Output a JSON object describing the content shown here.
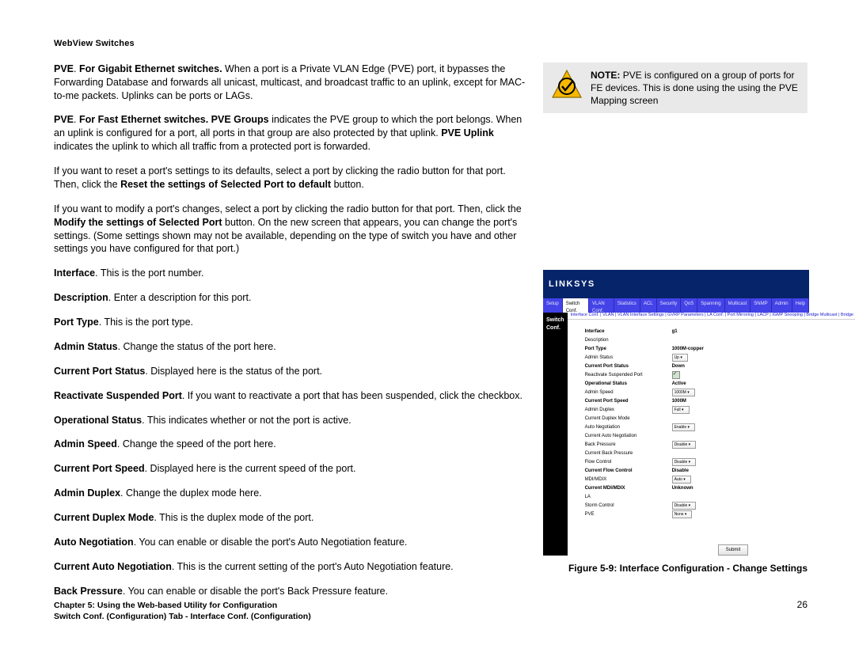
{
  "doc_title": "WebView Switches",
  "paragraphs": [
    {
      "bold_runs": [
        "PVE",
        ". ",
        "For Gigabit Ethernet switches.",
        " When a port is a Private VLAN Edge (PVE) port, it bypasses the Forwarding Database and forwards all unicast, multicast, and broadcast traffic to an uplink, except for MAC-to-me packets. Uplinks can be ports or LAGs."
      ]
    },
    {
      "bold_runs": [
        "PVE",
        ". ",
        "For Fast Ethernet switches. PVE Groups",
        " indicates the PVE group to which the port belongs. When an uplink is configured for a port, all ports in that group are also protected by that uplink. ",
        "PVE Uplink",
        " indicates the uplink to which all traffic from a protected port is forwarded."
      ]
    },
    {
      "plain_before": "If you want to reset a port's settings to its defaults, select a port by clicking the radio button for that port. Then, click the ",
      "bold": "Reset the settings of Selected Port to default",
      "plain_after": " button."
    },
    {
      "plain_before": "If you want to modify a port's changes, select a port by clicking the radio button for that port. Then, click the ",
      "bold": "Modify the settings of Selected Port",
      "plain_after": " button. On the new screen that appears, you can change the port's settings. (Some settings shown may not be available, depending on the type of switch you have and other settings you have configured for that port.)"
    }
  ],
  "fields": [
    {
      "label": "Interface",
      "text": ". This is the port number."
    },
    {
      "label": "Description",
      "text": ". Enter a description for this port."
    },
    {
      "label": "Port Type",
      "text": ". This is the port type."
    },
    {
      "label": "Admin Status",
      "text": ". Change the status of the port here."
    },
    {
      "label": "Current Port Status",
      "text": ". Displayed here is the status of the port."
    },
    {
      "label": "Reactivate Suspended Port",
      "text": ". If you want to reactivate a port that has been suspended, click the checkbox."
    },
    {
      "label": "Operational Status",
      "text": ". This indicates whether or not the port is active."
    },
    {
      "label": "Admin Speed",
      "text": ". Change the speed of the port here."
    },
    {
      "label": "Current Port Speed",
      "text": ". Displayed here is the current speed of the port."
    },
    {
      "label": "Admin Duplex",
      "text": ". Change the duplex mode here."
    },
    {
      "label": "Current Duplex Mode",
      "text": ". This is the duplex mode of the port."
    },
    {
      "label": "Auto Negotiation",
      "text": ". You can enable or disable the port's Auto Negotiation feature."
    },
    {
      "label": "Current Auto Negotiation",
      "text": ". This is the current setting of the port's Auto Negotiation feature."
    },
    {
      "label": "Back Pressure",
      "text": ". You can enable or disable the port's Back Pressure feature."
    }
  ],
  "note": {
    "label": "NOTE:",
    "body": "PVE is configured on a group of ports for FE devices. This is done using the using the PVE Mapping screen"
  },
  "figure": {
    "brand": "LINKSYS",
    "nav_label": "Switch Conf.",
    "top_tabs": [
      "Setup",
      "Switch Conf.",
      "VLAN Conf.",
      "Statistics",
      "ACL",
      "Security",
      "QoS",
      "Spanning",
      "Multicast",
      "SNMP",
      "Admin",
      "Help"
    ],
    "sub_tabs": "Interface Conf.  | VLAN  | VLAN Interface Settings  | GVRP Parameters  | LA Conf.  | Port Mirroring  | LACP  | IGMP Snooping  | Bridge Multicast  | Bridge MulticastForward All  |",
    "rows": [
      {
        "label": "Interface",
        "value": "g1",
        "type": "text",
        "bold": true
      },
      {
        "label": "Description",
        "value": "",
        "type": "text"
      },
      {
        "label": "Port Type",
        "value": "1000M-copper",
        "type": "text",
        "bold": true
      },
      {
        "label": "Admin Status",
        "value": "Up",
        "type": "select"
      },
      {
        "label": "Current Port Status",
        "value": "Down",
        "type": "text",
        "bold": true
      },
      {
        "label": "Reactivate Suspended Port",
        "value": "",
        "type": "check"
      },
      {
        "label": "Operational Status",
        "value": "Active",
        "type": "text",
        "bold": true
      },
      {
        "label": "Admin Speed",
        "value": "1000M",
        "type": "select"
      },
      {
        "label": "Current Port Speed",
        "value": "1000M",
        "type": "text",
        "bold": true
      },
      {
        "label": "Admin Duplex",
        "value": "Full",
        "type": "select"
      },
      {
        "label": "Current Duplex Mode",
        "value": "",
        "type": "text"
      },
      {
        "label": "Auto Negotiation",
        "value": "Enable",
        "type": "select"
      },
      {
        "label": "Current Auto Negotiation",
        "value": "",
        "type": "text"
      },
      {
        "label": "Back Pressure",
        "value": "Disable",
        "type": "select"
      },
      {
        "label": "Current Back Pressure",
        "value": "",
        "type": "text"
      },
      {
        "label": "Flow Control",
        "value": "Disable",
        "type": "select"
      },
      {
        "label": "Current Flow Control",
        "value": "Disable",
        "type": "text",
        "bold": true
      },
      {
        "label": "MDI/MDIX",
        "value": "Auto",
        "type": "select"
      },
      {
        "label": "Current MDI/MDIX",
        "value": "Unknown",
        "type": "text",
        "bold": true
      },
      {
        "label": "LA",
        "value": "",
        "type": "text"
      },
      {
        "label": "Storm Control",
        "value": "Disable",
        "type": "select"
      },
      {
        "label": "PVE",
        "value": "None",
        "type": "select"
      }
    ],
    "submit": "Submit",
    "caption": "Figure 5-9: Interface Configuration - Change Settings"
  },
  "footer": {
    "chapter": "Chapter 5: Using the Web-based Utility for Configuration",
    "section": "Switch Conf. (Configuration) Tab - Interface Conf. (Configuration)",
    "page": "26"
  }
}
